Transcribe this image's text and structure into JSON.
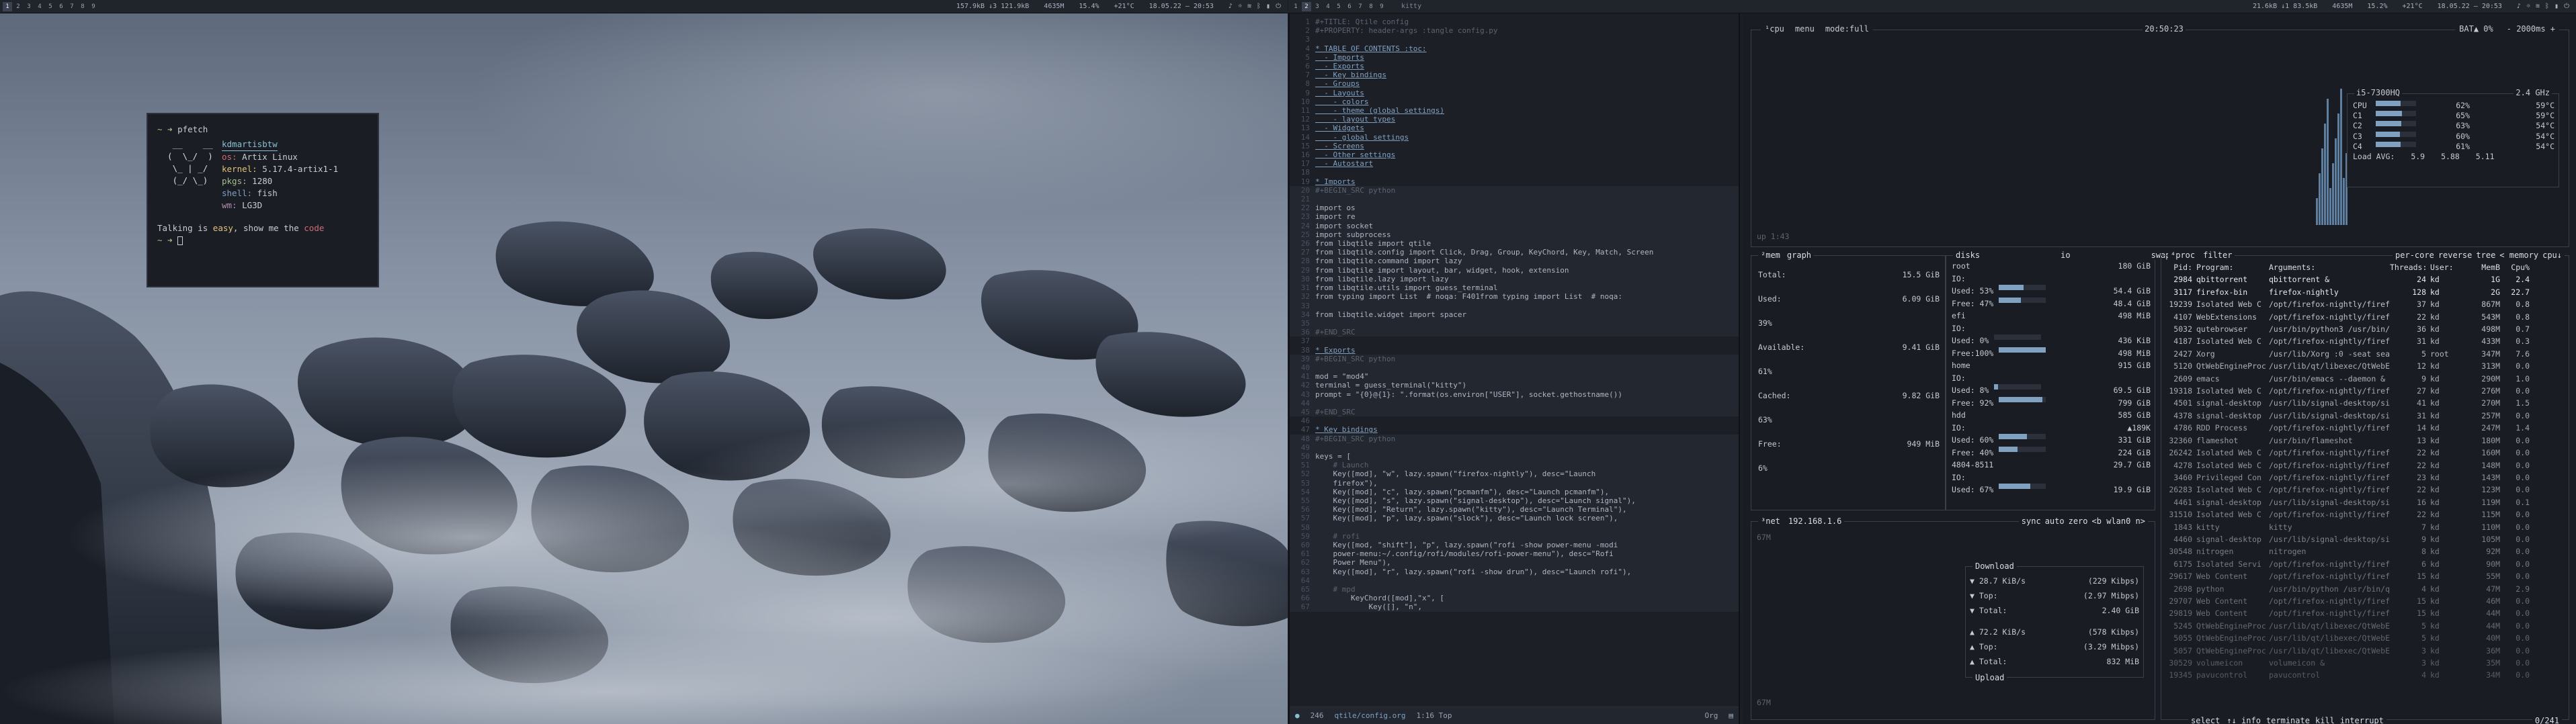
{
  "left_bar": {
    "workspaces": [
      "1",
      "2",
      "3",
      "4",
      "5",
      "6",
      "7",
      "8",
      "9"
    ],
    "active_workspace": 0,
    "net": "157.9kB ↓3 121.9kB",
    "cpu_freq": "4635M",
    "mem": "15.4%",
    "temp": "+21°C",
    "clock": "18.05.22 — 20:53",
    "icons": [
      "volume-icon",
      "brightness-icon",
      "wifi-icon",
      "bluetooth-icon",
      "battery-icon",
      "power-icon"
    ]
  },
  "right_bar": {
    "workspaces": [
      "1",
      "2",
      "3",
      "4",
      "5",
      "6",
      "7",
      "8",
      "9"
    ],
    "active_workspace": 1,
    "window_title": "kitty",
    "net": "21.6kB ↓1 83.5kB",
    "cpu_freq": "4635M",
    "mem": "15.2%",
    "temp": "+21°C",
    "clock": "18.05.22 — 20:53"
  },
  "pfetch": {
    "prompt": "~ ➜",
    "command": "pfetch",
    "user_host": "kdmartisbtw",
    "logo": [
      "   __    __   ",
      "  (  \\_/  )  ",
      "   \\_ | _/   ",
      "   (_/ \\_)   "
    ],
    "info": [
      {
        "key": "os:",
        "value": "Artix Linux"
      },
      {
        "key": "kernel:",
        "value": "5.17.4-artix1-1"
      },
      {
        "key": "pkgs:",
        "value": "1280"
      },
      {
        "key": "shell:",
        "value": "fish"
      },
      {
        "key": "wm:",
        "value": "LG3D"
      }
    ],
    "message_pre": "Talking is ",
    "message_easy": "easy",
    "message_mid": ", show me the ",
    "message_code": "code",
    "prompt2": "~ ➜"
  },
  "editor": {
    "lines": [
      {
        "n": "1",
        "t": "#+TITLE: Qtile config",
        "c": "cm"
      },
      {
        "n": "2",
        "t": "#+PROPERTY: header-args :tangle config.py",
        "c": "cm"
      },
      {
        "n": "3",
        "t": "",
        "c": "txt"
      },
      {
        "n": "4",
        "t": "* TABLE OF CONTENTS :toc:",
        "c": "hd"
      },
      {
        "n": "5",
        "t": "  - Imports",
        "c": "hd"
      },
      {
        "n": "6",
        "t": "  - Exports",
        "c": "hd"
      },
      {
        "n": "7",
        "t": "  - Key bindings",
        "c": "hd"
      },
      {
        "n": "8",
        "t": "  - Groups",
        "c": "hd"
      },
      {
        "n": "9",
        "t": "  - Layouts",
        "c": "hd"
      },
      {
        "n": "10",
        "t": "    - colors",
        "c": "hd"
      },
      {
        "n": "11",
        "t": "    - theme (global settings)",
        "c": "hd"
      },
      {
        "n": "12",
        "t": "    - layout types",
        "c": "hd"
      },
      {
        "n": "13",
        "t": "  - Widgets",
        "c": "hd"
      },
      {
        "n": "14",
        "t": "    - global settings",
        "c": "hd"
      },
      {
        "n": "15",
        "t": "  - Screens",
        "c": "hd"
      },
      {
        "n": "16",
        "t": "  - Other settings",
        "c": "hd"
      },
      {
        "n": "17",
        "t": "  - Autostart",
        "c": "hd"
      },
      {
        "n": "18",
        "t": "",
        "c": "txt"
      },
      {
        "n": "19",
        "t": "* Imports",
        "c": "hd"
      },
      {
        "n": "20",
        "t": "#+BEGIN_SRC python",
        "c": "cm"
      },
      {
        "n": "21",
        "t": "",
        "c": "txt"
      },
      {
        "n": "22",
        "t": "import os",
        "c": "txt"
      },
      {
        "n": "23",
        "t": "import re",
        "c": "txt"
      },
      {
        "n": "24",
        "t": "import socket",
        "c": "txt"
      },
      {
        "n": "25",
        "t": "import subprocess",
        "c": "txt"
      },
      {
        "n": "26",
        "t": "from libqtile import qtile",
        "c": "txt"
      },
      {
        "n": "27",
        "t": "from libqtile.config import Click, Drag, Group, KeyChord, Key, Match, Screen",
        "c": "txt"
      },
      {
        "n": "28",
        "t": "from libqtile.command import lazy",
        "c": "txt"
      },
      {
        "n": "29",
        "t": "from libqtile import layout, bar, widget, hook, extension",
        "c": "txt"
      },
      {
        "n": "30",
        "t": "from libqtile.lazy import lazy",
        "c": "txt"
      },
      {
        "n": "31",
        "t": "from libqtile.utils import guess_terminal",
        "c": "txt"
      },
      {
        "n": "32",
        "t": "from typing import List  # noqa: F401from typing import List  # noqa: ",
        "c": "txt"
      },
      {
        "n": "33",
        "t": "",
        "c": "txt"
      },
      {
        "n": "34",
        "t": "from libqtile.widget import spacer",
        "c": "txt"
      },
      {
        "n": "35",
        "t": "",
        "c": "txt"
      },
      {
        "n": "36",
        "t": "#+END_SRC",
        "c": "cm"
      },
      {
        "n": "37",
        "t": "",
        "c": "txt"
      },
      {
        "n": "38",
        "t": "* Exports",
        "c": "hd"
      },
      {
        "n": "39",
        "t": "#+BEGIN_SRC python",
        "c": "cm"
      },
      {
        "n": "40",
        "t": "",
        "c": "txt"
      },
      {
        "n": "41",
        "t": "mod = \"mod4\"",
        "c": "txt"
      },
      {
        "n": "42",
        "t": "terminal = guess_terminal(\"kitty\")",
        "c": "txt"
      },
      {
        "n": "43",
        "t": "prompt = \"{0}@{1}: \".format(os.environ[\"USER\"], socket.gethostname())",
        "c": "txt"
      },
      {
        "n": "44",
        "t": "",
        "c": "txt"
      },
      {
        "n": "45",
        "t": "#+END_SRC",
        "c": "cm"
      },
      {
        "n": "46",
        "t": "",
        "c": "txt"
      },
      {
        "n": "47",
        "t": "* Key bindings",
        "c": "hd"
      },
      {
        "n": "48",
        "t": "#+BEGIN_SRC python",
        "c": "cm"
      },
      {
        "n": "49",
        "t": "",
        "c": "txt"
      },
      {
        "n": "50",
        "t": "keys = [",
        "c": "txt"
      },
      {
        "n": "51",
        "t": "    # Launch",
        "c": "cm"
      },
      {
        "n": "52",
        "t": "    Key([mod], \"w\", lazy.spawn(\"firefox-nightly\"), desc=\"Launch",
        "c": "txt"
      },
      {
        "n": "53",
        "t": "    firefox\"),",
        "c": "txt"
      },
      {
        "n": "54",
        "t": "    Key([mod], \"c\", lazy.spawn(\"pcmanfm\"), desc=\"Launch pcmanfm\"),",
        "c": "txt"
      },
      {
        "n": "55",
        "t": "    Key([mod], \"s\", lazy.spawn(\"signal-desktop\"), desc=\"Launch signal\"),",
        "c": "txt"
      },
      {
        "n": "56",
        "t": "    Key([mod], \"Return\", lazy.spawn(\"kitty\"), desc=\"Launch Terminal\"),",
        "c": "txt"
      },
      {
        "n": "57",
        "t": "    Key([mod], \"p\", lazy.spawn(\"slock\"), desc=\"Launch lock screen\"),",
        "c": "txt"
      },
      {
        "n": "58",
        "t": "",
        "c": "txt"
      },
      {
        "n": "59",
        "t": "    # rofi",
        "c": "cm"
      },
      {
        "n": "60",
        "t": "    Key([mod, \"shift\"], \"p\", lazy.spawn(\"rofi -show power-menu -modi",
        "c": "txt"
      },
      {
        "n": "61",
        "t": "    power-menu:~/.config/rofi/modules/rofi-power-menu\"), desc=\"Rofi",
        "c": "txt"
      },
      {
        "n": "62",
        "t": "    Power Menu\"),",
        "c": "txt"
      },
      {
        "n": "63",
        "t": "    Key([mod], \"r\", lazy.spawn(\"rofi -show drun\"), desc=\"Launch rofi\"),",
        "c": "txt"
      },
      {
        "n": "64",
        "t": "",
        "c": "txt"
      },
      {
        "n": "65",
        "t": "    # mpd",
        "c": "cm"
      },
      {
        "n": "66",
        "t": "        KeyChord([mod],\"x\", [",
        "c": "txt"
      },
      {
        "n": "67",
        "t": "            Key([], \"n\",",
        "c": "txt"
      }
    ],
    "mode_indicator": "●",
    "line_count": "246",
    "filename": "qtile/config.org",
    "position": "1:16 Top",
    "major_mode": "Org"
  },
  "btop": {
    "cpu_box_labels": [
      "¹cpu",
      "menu",
      "mode:full"
    ],
    "clock": "20:50:23",
    "battery": "BAT▲ 0%",
    "refresh": "- 2000ms +",
    "cpu_model": "i5-7300HQ",
    "cpu_freq": "2.4 GHz",
    "uptime": "up 1:43",
    "cores": [
      {
        "name": "CPU",
        "pct": "62%",
        "temp": "59°C",
        "fill": 0.62
      },
      {
        "name": "C1",
        "pct": "65%",
        "temp": "59°C",
        "fill": 0.65
      },
      {
        "name": "C2",
        "pct": "63%",
        "temp": "54°C",
        "fill": 0.63
      },
      {
        "name": "C3",
        "pct": "60%",
        "temp": "54°C",
        "fill": 0.6
      },
      {
        "name": "C4",
        "pct": "61%",
        "temp": "54°C",
        "fill": 0.61
      }
    ],
    "load_avg_label": "Load AVG:",
    "load_avg": [
      "5.9",
      "5.88",
      "5.11"
    ],
    "mem": {
      "label": "²mem",
      "graph_label": "graph",
      "rows": [
        {
          "k": "Total:",
          "v": "15.5 GiB"
        },
        {
          "k": "Used:",
          "v": "6.09 GiB"
        },
        {
          "k": "39%",
          "v": ""
        },
        {
          "k": "Available:",
          "v": "9.41 GiB"
        },
        {
          "k": "61%",
          "v": ""
        },
        {
          "k": "Cached:",
          "v": "9.82 GiB"
        },
        {
          "k": "63%",
          "v": ""
        },
        {
          "k": "Free:",
          "v": "949 MiB"
        },
        {
          "k": "6%",
          "v": ""
        }
      ]
    },
    "disks": {
      "label": "disks",
      "io_label": "io",
      "swap_label": "swap",
      "rows": [
        {
          "k": "root",
          "v": "180 GiB"
        },
        {
          "k": "IO:",
          "v": ""
        },
        {
          "k": "Used: 53%",
          "v": "54.4 GiB",
          "fill": 0.53
        },
        {
          "k": "Free: 47%",
          "v": "48.4 GiB",
          "fill": 0.47
        },
        {
          "k": "efi",
          "v": "498 MiB"
        },
        {
          "k": "IO:",
          "v": ""
        },
        {
          "k": "Used:  0%",
          "v": "436 KiB",
          "fill": 0.0
        },
        {
          "k": "Free:100%",
          "v": "498 MiB",
          "fill": 1.0
        },
        {
          "k": "home",
          "v": "915 GiB"
        },
        {
          "k": "IO:",
          "v": ""
        },
        {
          "k": "Used:  8%",
          "v": "69.5 GiB",
          "fill": 0.08
        },
        {
          "k": "Free: 92%",
          "v": "799 GiB",
          "fill": 0.92
        },
        {
          "k": "hdd",
          "v": "585 GiB"
        },
        {
          "k": "IO:",
          "v": "▲189K"
        },
        {
          "k": "Used: 60%",
          "v": "331 GiB",
          "fill": 0.6
        },
        {
          "k": "Free: 40%",
          "v": "224 GiB",
          "fill": 0.4
        },
        {
          "k": "4804-8511",
          "v": "29.7 GiB"
        },
        {
          "k": "IO:",
          "v": ""
        },
        {
          "k": "Used: 67%",
          "v": "19.9 GiB",
          "fill": 0.67
        }
      ]
    },
    "net": {
      "label": "³net",
      "iface_ip": "192.168.1.6",
      "controls": [
        "sync",
        "auto",
        "zero",
        "<b wlan0 n>"
      ],
      "scale_top": "67M",
      "scale_bot": "67M",
      "download_label": "Download",
      "upload_label": "Upload",
      "rows": [
        {
          "k": "▼ 28.7 KiB/s",
          "v": "(229 Kibps)"
        },
        {
          "k": "▼ Top:",
          "v": "(2.97 Mibps)"
        },
        {
          "k": "▼ Total:",
          "v": "2.40 GiB"
        },
        {
          "k": "▲ 72.2 KiB/s",
          "v": "(578 Kibps)"
        },
        {
          "k": "▲ Top:",
          "v": "(3.29 Mibps)"
        },
        {
          "k": "▲ Total:",
          "v": "832 MiB"
        }
      ]
    },
    "proc": {
      "label": "⁴proc",
      "filter": "filter",
      "controls": [
        "per-core",
        "reverse",
        "tree",
        "< memory",
        "cpu↓"
      ],
      "headers": [
        "Pid:",
        "Program:",
        "Arguments:",
        "Threads:",
        "User:",
        "MemB",
        "Cpu%"
      ],
      "rows": [
        [
          "2984",
          "qbittorrent",
          "qbittorrent &",
          "24",
          "kd",
          "1G",
          "2.4"
        ],
        [
          "3117",
          "firefox-bin",
          "firefox-nightly",
          "128",
          "kd",
          "2G",
          "22.7"
        ],
        [
          "19239",
          "Isolated Web C",
          "/opt/firefox-nightly/firef",
          "37",
          "kd",
          "867M",
          "0.8"
        ],
        [
          "4107",
          "WebExtensions",
          "/opt/firefox-nightly/firef",
          "22",
          "kd",
          "543M",
          "0.8"
        ],
        [
          "5032",
          "qutebrowser",
          "/usr/bin/python3 /usr/bin/qute",
          "36",
          "kd",
          "498M",
          "0.7"
        ],
        [
          "4187",
          "Isolated Web C",
          "/opt/firefox-nightly/firef",
          "31",
          "kd",
          "433M",
          "0.3"
        ],
        [
          "2427",
          "Xorg",
          "/usr/lib/Xorg :0 -seat sea",
          "5",
          "root",
          "347M",
          "7.6"
        ],
        [
          "5120",
          "QtWebEngineProc",
          "/usr/lib/qt/libexec/QtWebE",
          "12",
          "kd",
          "313M",
          "0.0"
        ],
        [
          "2609",
          "emacs",
          "/usr/bin/emacs --daemon &",
          "9",
          "kd",
          "290M",
          "1.0"
        ],
        [
          "19318",
          "Isolated Web C",
          "/opt/firefox-nightly/firef",
          "27",
          "kd",
          "276M",
          "0.0"
        ],
        [
          "4501",
          "signal-desktop",
          "/usr/lib/signal-desktop/si",
          "41",
          "kd",
          "270M",
          "1.5"
        ],
        [
          "4378",
          "signal-desktop",
          "/usr/lib/signal-desktop/si",
          "31",
          "kd",
          "257M",
          "0.0"
        ],
        [
          "4786",
          "RDD Process",
          "/opt/firefox-nightly/firef",
          "14",
          "kd",
          "247M",
          "1.4"
        ],
        [
          "32360",
          "flameshot",
          "/usr/bin/flameshot",
          "13",
          "kd",
          "180M",
          "0.0"
        ],
        [
          "26242",
          "Isolated Web C",
          "/opt/firefox-nightly/firef",
          "22",
          "kd",
          "160M",
          "0.0"
        ],
        [
          "4278",
          "Isolated Web C",
          "/opt/firefox-nightly/firef",
          "22",
          "kd",
          "148M",
          "0.0"
        ],
        [
          "3460",
          "Privileged Con",
          "/opt/firefox-nightly/firef",
          "23",
          "kd",
          "143M",
          "0.0"
        ],
        [
          "26283",
          "Isolated Web C",
          "/opt/firefox-nightly/firef",
          "22",
          "kd",
          "123M",
          "0.0"
        ],
        [
          "4461",
          "signal-desktop",
          "/usr/lib/signal-desktop/si",
          "16",
          "kd",
          "119M",
          "0.1"
        ],
        [
          "31510",
          "Isolated Web C",
          "/opt/firefox-nightly/firef",
          "22",
          "kd",
          "115M",
          "0.0"
        ],
        [
          "1843",
          "kitty",
          "kitty",
          "7",
          "kd",
          "110M",
          "0.0"
        ],
        [
          "4460",
          "signal-desktop",
          "/usr/lib/signal-desktop/si",
          "9",
          "kd",
          "105M",
          "0.0"
        ],
        [
          "30548",
          "nitrogen",
          "nitrogen",
          "8",
          "kd",
          "92M",
          "0.0"
        ],
        [
          "6175",
          "Isolated Servi",
          "/opt/firefox-nightly/firef",
          "6",
          "kd",
          "90M",
          "0.0"
        ],
        [
          "29617",
          "Web Content",
          "/opt/firefox-nightly/firef",
          "15",
          "kd",
          "55M",
          "0.0"
        ],
        [
          "2698",
          "python",
          "/usr/bin/python /usr/bin/q",
          "4",
          "kd",
          "47M",
          "2.9"
        ],
        [
          "29707",
          "Web Content",
          "/opt/firefox-nightly/firef",
          "15",
          "kd",
          "46M",
          "0.0"
        ],
        [
          "29819",
          "Web Content",
          "/opt/firefox-nightly/firef",
          "15",
          "kd",
          "44M",
          "0.0"
        ],
        [
          "5245",
          "QtWebEngineProc",
          "/usr/lib/qt/libexec/QtWebE",
          "5",
          "kd",
          "44M",
          "0.0"
        ],
        [
          "5055",
          "QtWebEngineProc",
          "/usr/lib/qt/libexec/QtWebE",
          "5",
          "kd",
          "40M",
          "0.0"
        ],
        [
          "5057",
          "QtWebEngineProc",
          "/usr/lib/qt/libexec/QtWebE",
          "3",
          "kd",
          "36M",
          "0.0"
        ],
        [
          "30529",
          "volumeicon",
          "volumeicon &",
          "3",
          "kd",
          "35M",
          "0.0"
        ],
        [
          "19345",
          "pavucontrol",
          "pavucontrol",
          "4",
          "kd",
          "34M",
          "0.0"
        ]
      ],
      "footer_select": "select",
      "footer_controls": [
        "↑↓ info",
        "terminate",
        "kill",
        "interrupt"
      ],
      "footer_count": "0/241"
    }
  }
}
